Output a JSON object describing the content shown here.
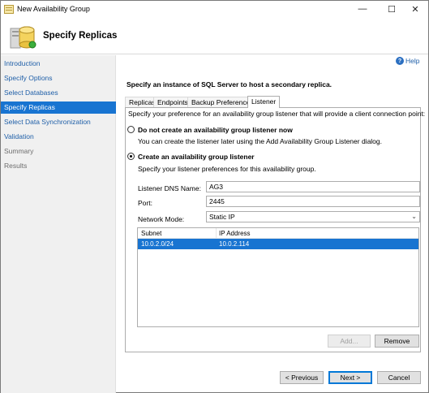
{
  "window": {
    "title": "New Availability Group",
    "controls": {
      "minimize": "—",
      "maximize": "☐",
      "close": "✕"
    }
  },
  "header": {
    "title": "Specify Replicas"
  },
  "sidebar": {
    "items": [
      {
        "label": "Introduction",
        "state": "link"
      },
      {
        "label": "Specify Options",
        "state": "link"
      },
      {
        "label": "Select Databases",
        "state": "link"
      },
      {
        "label": "Specify Replicas",
        "state": "active"
      },
      {
        "label": "Select Data Synchronization",
        "state": "link"
      },
      {
        "label": "Validation",
        "state": "link"
      },
      {
        "label": "Summary",
        "state": "disabled"
      },
      {
        "label": "Results",
        "state": "disabled"
      }
    ]
  },
  "help": {
    "label": "Help",
    "icon": "help-icon"
  },
  "main": {
    "instruction": "Specify an instance of SQL Server to host a secondary replica.",
    "tabs": [
      {
        "label": "Replicas"
      },
      {
        "label": "Endpoints"
      },
      {
        "label": "Backup Preferences"
      },
      {
        "label": "Listener",
        "active": true
      }
    ],
    "listener": {
      "intro": "Specify your preference for an availability group listener that will provide a client connection point:",
      "option_none": {
        "label": "Do not create an availability group listener now",
        "description": "You can create the listener later using the Add Availability Group Listener dialog.",
        "checked": false
      },
      "option_create": {
        "label": "Create an availability group listener",
        "description": "Specify your listener preferences for this availability group.",
        "checked": true
      },
      "dns_name_label": "Listener DNS Name:",
      "dns_name_value": "AG3",
      "port_label": "Port:",
      "port_value": "2445",
      "network_mode_label": "Network Mode:",
      "network_mode_value": "Static IP",
      "grid": {
        "columns": [
          "Subnet",
          "IP Address"
        ],
        "rows": [
          {
            "subnet": "10.0.2.0/24",
            "ip": "10.0.2.114",
            "selected": true
          }
        ]
      },
      "add_button": "Add...",
      "remove_button": "Remove"
    }
  },
  "footer": {
    "previous": "< Previous",
    "next": "Next >",
    "cancel": "Cancel"
  },
  "colors": {
    "accent": "#1874d1",
    "link": "#1f5fa8",
    "sidebar_bg": "#f0f0f0"
  }
}
